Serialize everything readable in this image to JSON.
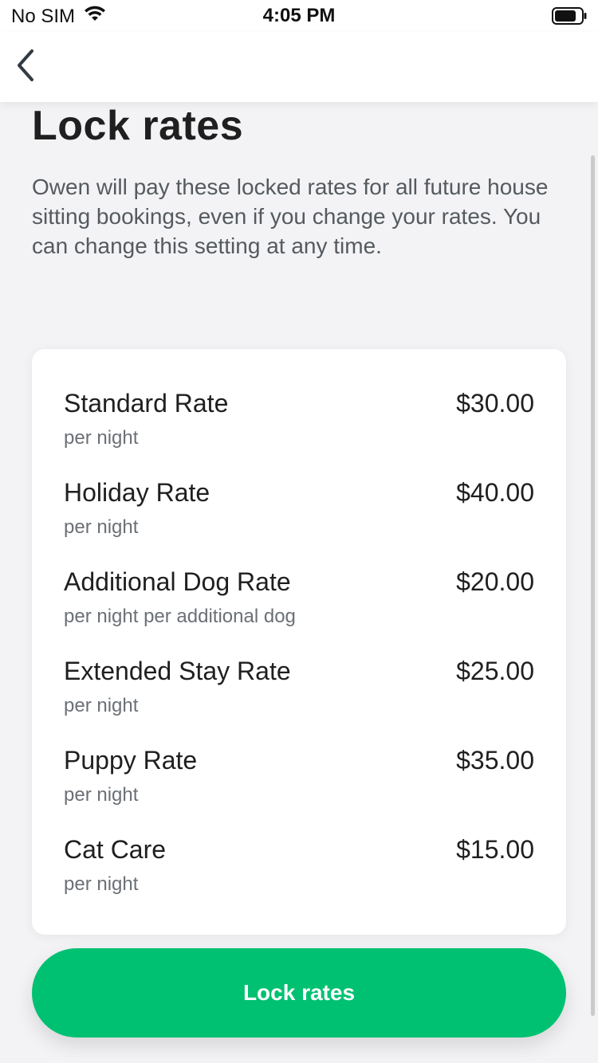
{
  "status_bar": {
    "carrier": "No SIM",
    "time": "4:05 PM",
    "wifi_icon": "wifi-icon",
    "battery_icon": "battery-icon"
  },
  "nav": {
    "back_icon": "chevron-left-icon"
  },
  "page": {
    "title": "Lock rates",
    "description": "Owen will pay these locked rates for all future house sitting bookings, even if you change your rates. You can change this setting at any time."
  },
  "rates": [
    {
      "name": "Standard Rate",
      "unit": "per night",
      "price": "$30.00"
    },
    {
      "name": "Holiday Rate",
      "unit": "per night",
      "price": "$40.00"
    },
    {
      "name": "Additional Dog Rate",
      "unit": "per night per additional dog",
      "price": "$20.00"
    },
    {
      "name": "Extended Stay Rate",
      "unit": "per night",
      "price": "$25.00"
    },
    {
      "name": "Puppy Rate",
      "unit": "per night",
      "price": "$35.00"
    },
    {
      "name": "Cat Care",
      "unit": "per night",
      "price": "$15.00"
    }
  ],
  "actions": {
    "lock_rates_label": "Lock rates"
  },
  "colors": {
    "accent": "#00c172",
    "background": "#f3f3f5",
    "card": "#ffffff",
    "primary_text": "#1f1f1f",
    "secondary_text": "#6b7076"
  }
}
